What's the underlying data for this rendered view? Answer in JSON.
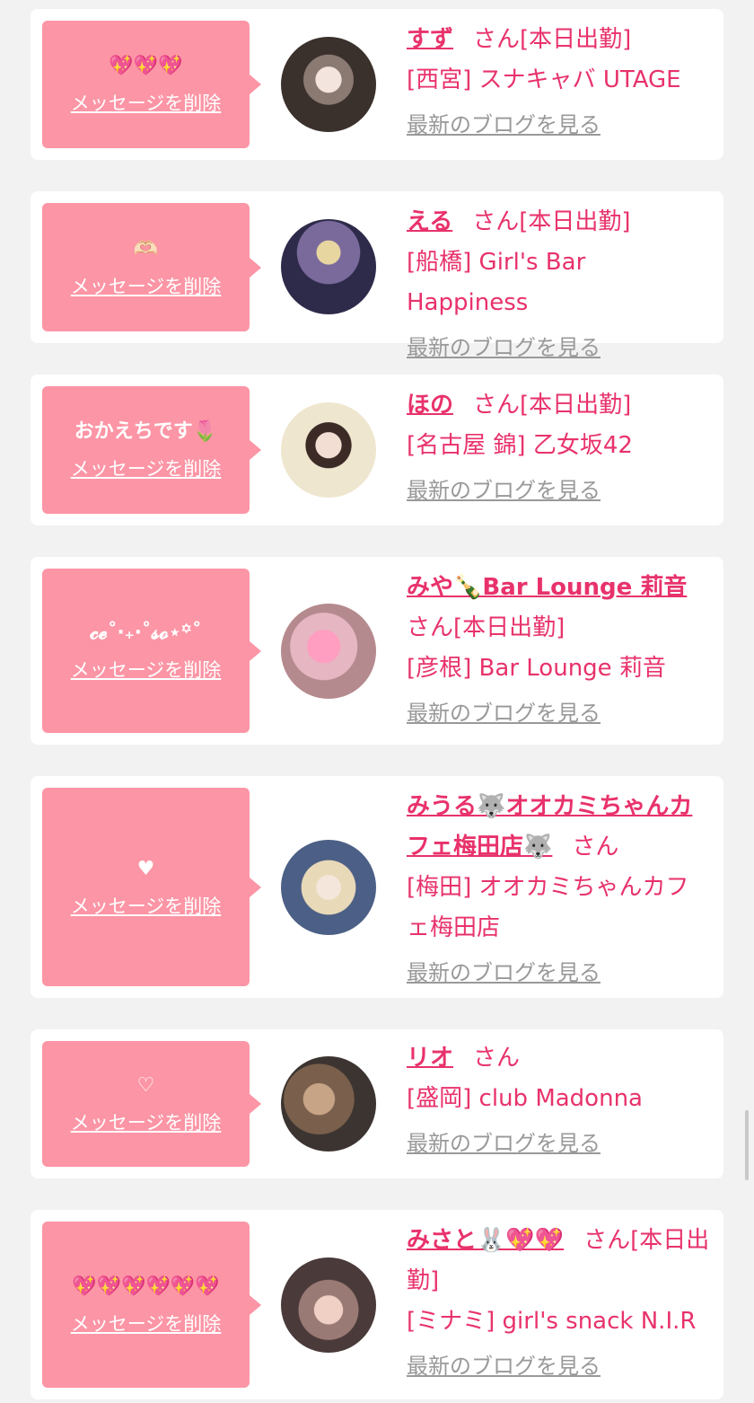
{
  "cards": [
    {
      "message": "💖💖💖",
      "delete_label": "メッセージを削除",
      "name": "すず",
      "suffix": "さん[本日出勤]",
      "shop": "[西宮] スナキャバ UTAGE",
      "blog_label": "最新のブログを見る"
    },
    {
      "message": "🫶🏻",
      "delete_label": "メッセージを削除",
      "name": "える",
      "suffix": "さん[本日出勤]",
      "shop": "[船橋] Girl's Bar Happiness",
      "blog_label": "最新のブログを見る"
    },
    {
      "message": "おかえちです🌷",
      "delete_label": "メッセージを削除",
      "name": "ほの",
      "suffix": "さん[本日出勤]",
      "shop": "[名古屋 錦] 乙女坂42",
      "blog_label": "最新のブログを見る"
    },
    {
      "message": "𝓬𝓮˚‧₊‧˚𝓼𝓸⋆꙳˚",
      "delete_label": "メッセージを削除",
      "name": "みや🍾Bar Lounge 莉音",
      "suffix": "さん[本日出勤]",
      "shop": "[彦根] Bar Lounge 莉音",
      "blog_label": "最新のブログを見る"
    },
    {
      "message": "♥",
      "delete_label": "メッセージを削除",
      "name": "みうる🐺オオカミちゃんカフェ梅田店🐺",
      "suffix": "さん",
      "shop": "[梅田] オオカミちゃんカフェ梅田店",
      "blog_label": "最新のブログを見る"
    },
    {
      "message": "♡",
      "delete_label": "メッセージを削除",
      "name": "リオ",
      "suffix": "さん",
      "shop": "[盛岡] club Madonna",
      "blog_label": "最新のブログを見る"
    },
    {
      "message": "💖💖💖💖💖💖",
      "delete_label": "メッセージを削除",
      "name": "みさと🐰💖💖",
      "suffix": "さん[本日出勤]",
      "shop": "[ミナミ] girl's snack N.I.R",
      "blog_label": "最新のブログを見る"
    }
  ],
  "colors": {
    "accent": "#e8326b",
    "bubble": "#fc95a5",
    "muted": "#999999",
    "page_bg": "#f2f2f2"
  }
}
